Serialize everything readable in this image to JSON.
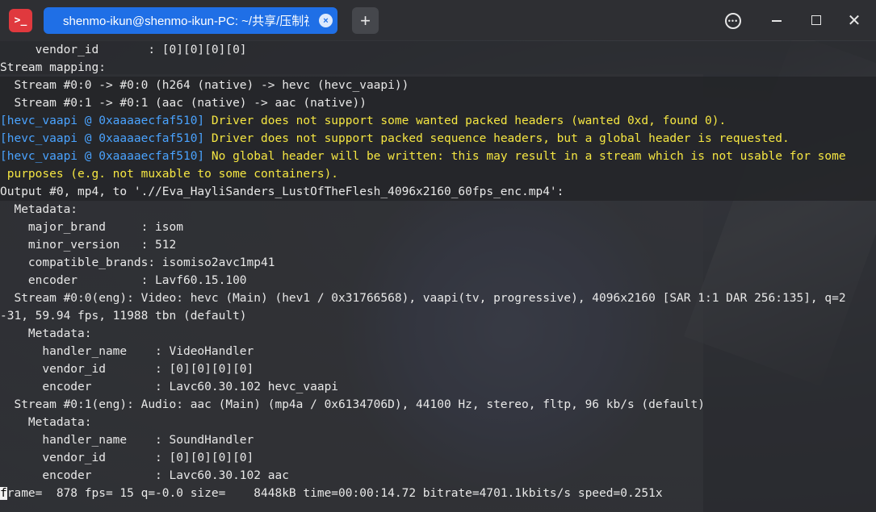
{
  "titlebar": {
    "app_icon_glyph": ">_",
    "tab_title": "shenmo-ikun@shenmo-ikun-PC: ~/共享/压制视频",
    "tab_close_glyph": "×",
    "new_tab_glyph": "+",
    "more_glyph": "•••",
    "close_glyph": "✕"
  },
  "colors": {
    "tab_active": "#1f6fe6",
    "app_icon": "#e0393e",
    "log_prefix": "#4aa3ff",
    "log_warning": "#f5e642"
  },
  "terminal": {
    "lines": [
      "     vendor_id       : [0][0][0][0]",
      "Stream mapping:",
      "  Stream #0:0 -> #0:0 (h264 (native) -> hevc (hevc_vaapi))",
      "  Stream #0:1 -> #0:1 (aac (native) -> aac (native))",
      "",
      "",
      "",
      "",
      "Output #0, mp4, to './/Eva_HayliSanders_LustOfTheFlesh_4096x2160_60fps_enc.mp4':",
      "  Metadata:",
      "    major_brand     : isom",
      "    minor_version   : 512",
      "    compatible_brands: isomiso2avc1mp41",
      "    encoder         : Lavf60.15.100",
      "  Stream #0:0(eng): Video: hevc (Main) (hev1 / 0x31766568), vaapi(tv, progressive), 4096x2160 [SAR 1:1 DAR 256:135], q=2",
      "-31, 59.94 fps, 11988 tbn (default)",
      "    Metadata:",
      "      handler_name    : VideoHandler",
      "      vendor_id       : [0][0][0][0]",
      "      encoder         : Lavc60.30.102 hevc_vaapi",
      "  Stream #0:1(eng): Audio: aac (Main) (mp4a / 0x6134706D), 44100 Hz, stereo, fltp, 96 kb/s (default)",
      "    Metadata:",
      "      handler_name    : SoundHandler",
      "      vendor_id       : [0][0][0][0]",
      "      encoder         : Lavc60.30.102 aac"
    ],
    "warnings": [
      {
        "prefix": "[hevc_vaapi @ 0xaaaaecfaf510]",
        "message": " Driver does not support some wanted packed headers (wanted 0xd, found 0)."
      },
      {
        "prefix": "[hevc_vaapi @ 0xaaaaecfaf510]",
        "message": " Driver does not support packed sequence headers, but a global header is requested."
      },
      {
        "prefix": "[hevc_vaapi @ 0xaaaaecfaf510]",
        "message": " No global header will be written: this may result in a stream which is not usable for some"
      },
      {
        "prefix": "",
        "message": " purposes (e.g. not muxable to some containers)."
      }
    ],
    "progress": {
      "cursor_char": "f",
      "text": "rame=  878 fps= 15 q=-0.0 size=    8448kB time=00:00:14.72 bitrate=4701.1kbits/s speed=0.251x"
    }
  }
}
